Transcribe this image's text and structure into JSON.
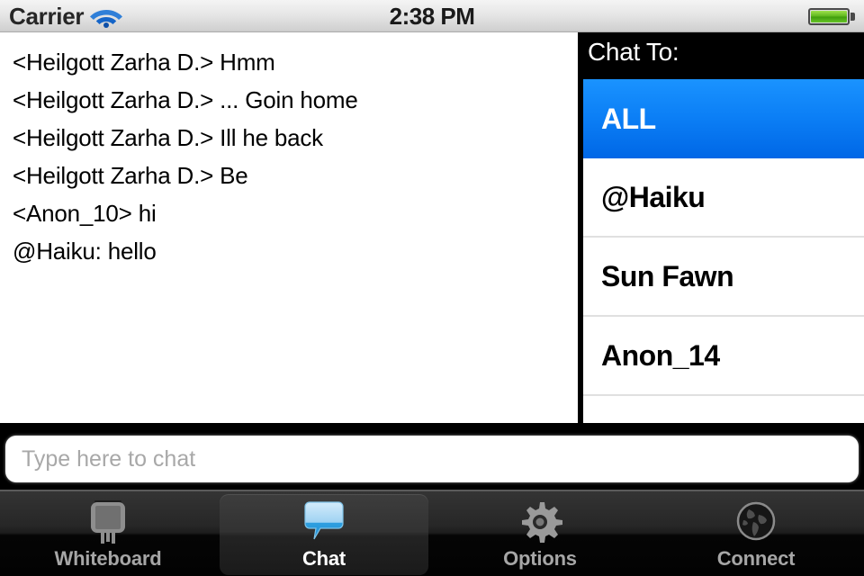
{
  "statusbar": {
    "carrier": "Carrier",
    "time": "2:38 PM",
    "wifi_icon": "wifi-icon",
    "battery_icon": "battery-icon",
    "accent_wifi": "#1e6fd9",
    "battery_color": "#5cb61c"
  },
  "chat": {
    "messages": [
      "<Heilgott Zarha D.> Hmm",
      "<Heilgott Zarha D.> ... Goin home",
      "<Heilgott Zarha D.> Ill he back",
      "<Heilgott Zarha D.> Be",
      "<Anon_10> hi",
      "@Haiku: hello"
    ]
  },
  "side_panel": {
    "header": "Chat To:",
    "selected_color": "#0b7ef5",
    "users": [
      {
        "label": "ALL",
        "selected": true
      },
      {
        "label": "@Haiku",
        "selected": false
      },
      {
        "label": "Sun Fawn",
        "selected": false
      },
      {
        "label": "Anon_14",
        "selected": false
      },
      {
        "label": "",
        "selected": false
      }
    ]
  },
  "input": {
    "value": "",
    "placeholder": "Type here to chat"
  },
  "tabbar": {
    "tabs": [
      {
        "label": "Whiteboard",
        "icon": "easel-icon",
        "active": false
      },
      {
        "label": "Chat",
        "icon": "speech-bubble-icon",
        "active": true
      },
      {
        "label": "Options",
        "icon": "gear-icon",
        "active": false
      },
      {
        "label": "Connect",
        "icon": "globe-icon",
        "active": false
      }
    ]
  }
}
